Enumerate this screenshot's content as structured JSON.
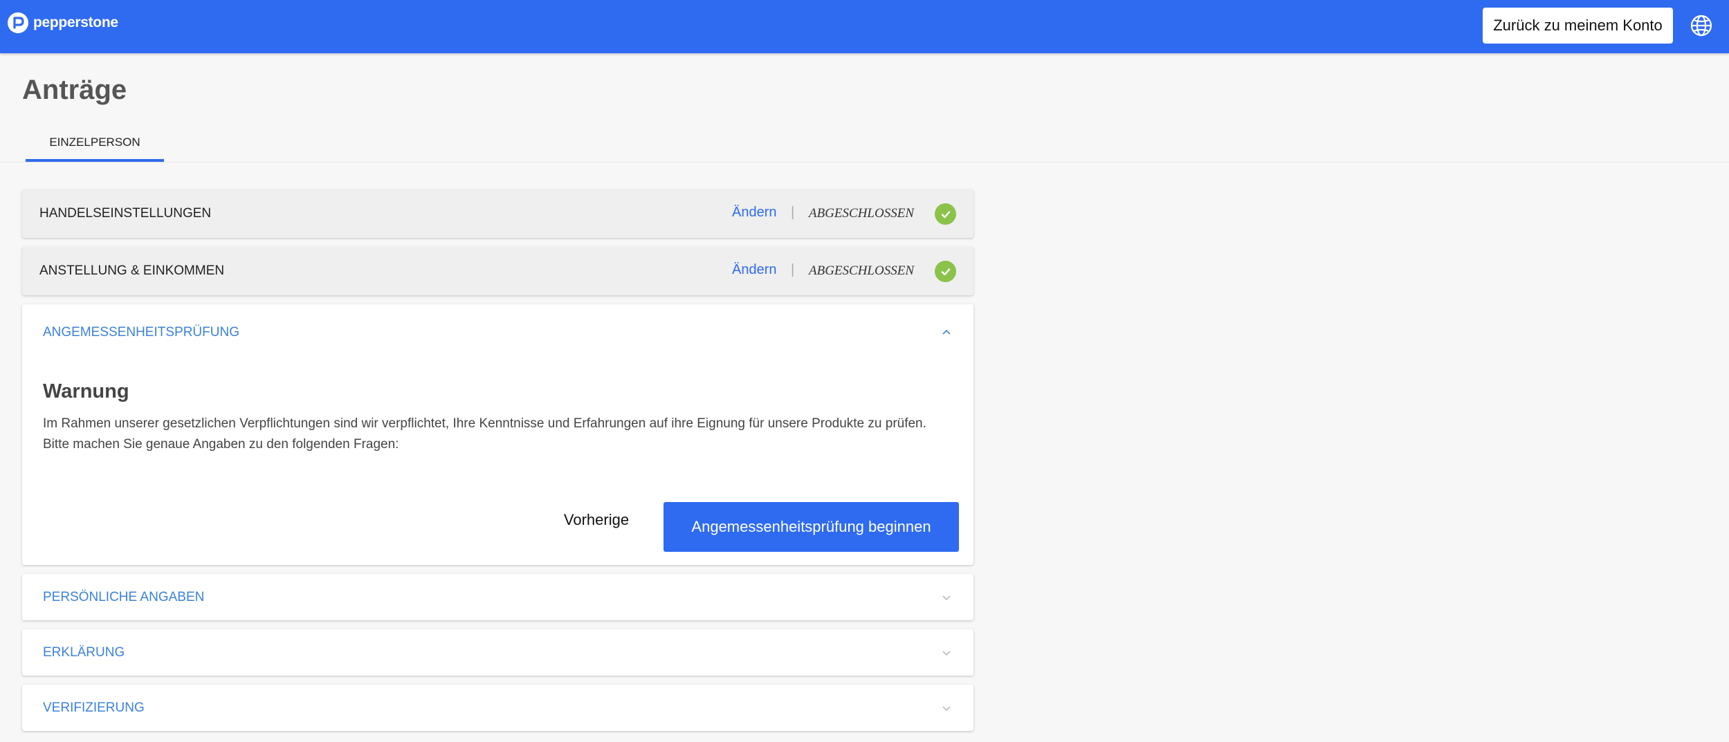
{
  "brand": {
    "name": "pepperstone",
    "accent": "#2f6bf0",
    "success": "#8bc34a",
    "link_blue": "#3b82d8"
  },
  "header": {
    "back_button": "Zurück zu meinem Konto",
    "language_icon": "globe-icon"
  },
  "page": {
    "title": "Anträge",
    "tabs": [
      {
        "label": "EINZELPERSON",
        "active": true
      }
    ]
  },
  "sections": [
    {
      "title": "HANDELSEINSTELLUNGEN",
      "edit_label": "Ändern",
      "separator": "|",
      "status": "ABGESCHLOSSEN",
      "state": "completed"
    },
    {
      "title": "ANSTELLUNG & EINKOMMEN",
      "edit_label": "Ändern",
      "separator": "|",
      "status": "ABGESCHLOSSEN",
      "state": "completed"
    },
    {
      "title": "ANGEMESSENHEITSPRÜFUNG",
      "state": "expanded"
    },
    {
      "title": "PERSÖNLICHE ANGABEN",
      "state": "collapsed"
    },
    {
      "title": "ERKLÄRUNG",
      "state": "collapsed"
    },
    {
      "title": "VERIFIZIERUNG",
      "state": "collapsed"
    }
  ],
  "warning": {
    "heading": "Warnung",
    "text": "Im Rahmen unserer gesetzlichen Verpflichtungen sind wir verpflichtet, Ihre Kenntnisse und Erfahrungen auf ihre Eignung für unsere Produkte zu prüfen. Bitte machen Sie genaue Angaben zu den folgenden Fragen:",
    "previous_button": "Vorherige",
    "start_button": "Angemessenheitsprüfung beginnen"
  }
}
